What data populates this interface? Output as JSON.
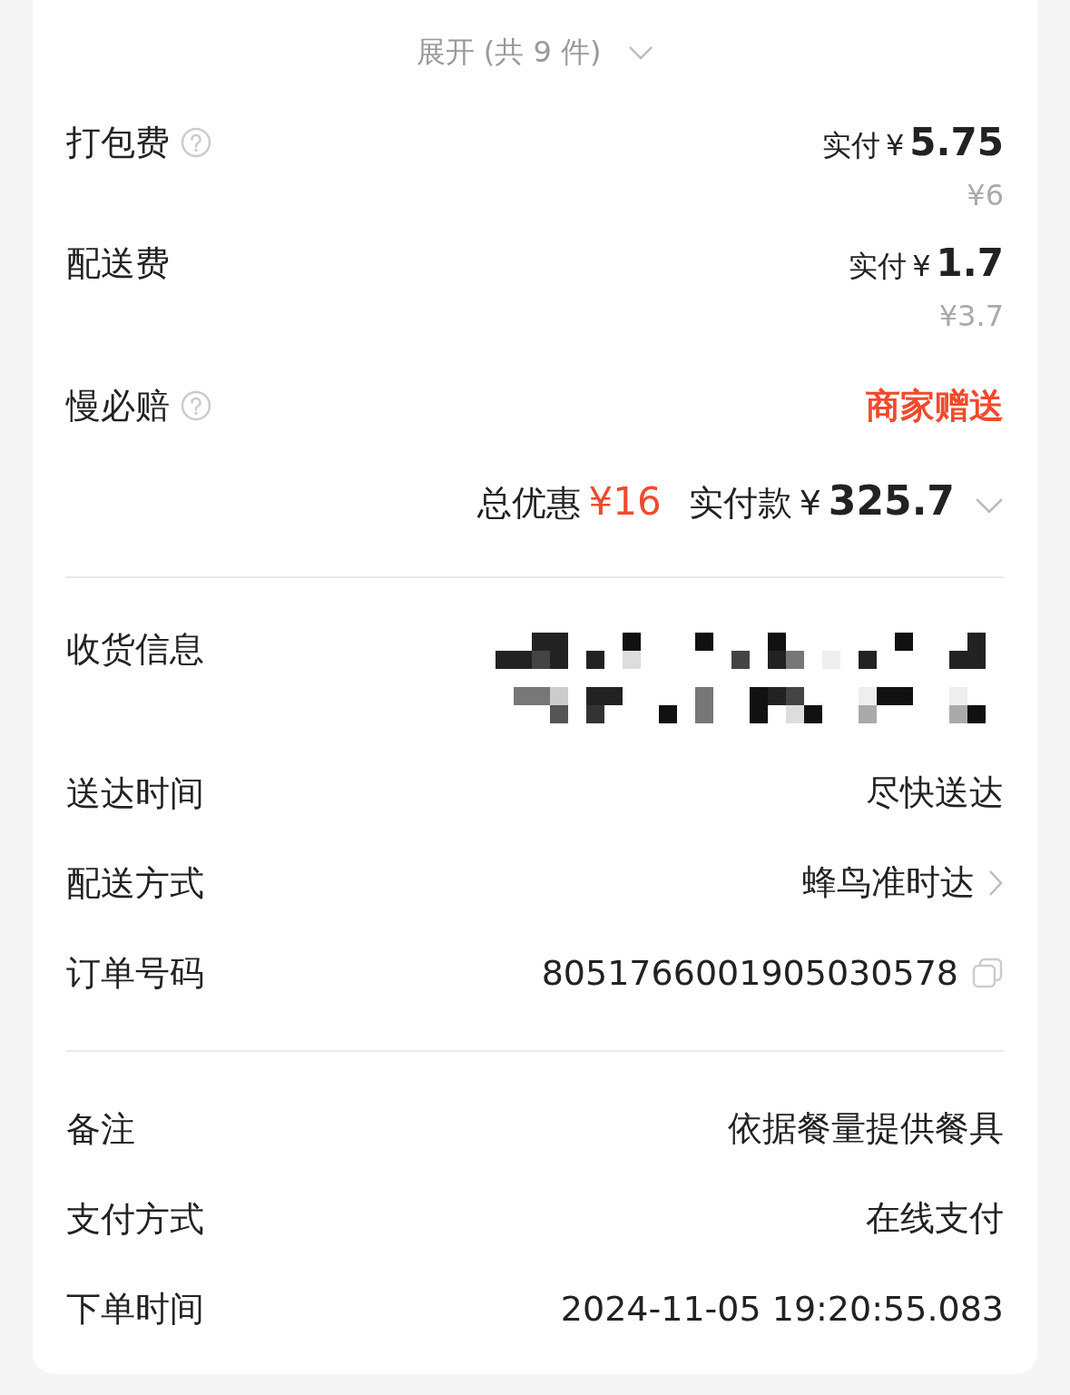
{
  "expand": {
    "label": "展开 (共 9 件)"
  },
  "fees": [
    {
      "kind": "price",
      "label": "打包费",
      "help": true,
      "paid_label": "实付",
      "currency": "¥",
      "paid": "5.75",
      "original": "¥6"
    },
    {
      "kind": "price",
      "label": "配送费",
      "help": false,
      "paid_label": "实付",
      "currency": "¥",
      "paid": "1.7",
      "original": "¥3.7"
    },
    {
      "kind": "gift",
      "label": "慢必赔",
      "help": true,
      "value": "商家赠送"
    }
  ],
  "summary": {
    "discount_label": "总优惠",
    "discount": "¥16",
    "paid_label": "实付款",
    "currency": "¥",
    "total": "325.7"
  },
  "sections": [
    [
      {
        "kind": "redacted",
        "label": "收货信息"
      },
      {
        "kind": "text",
        "label": "送达时间",
        "value": "尽快送达"
      },
      {
        "kind": "link",
        "label": "配送方式",
        "value": "蜂鸟准时达"
      },
      {
        "kind": "copy",
        "label": "订单号码",
        "value": "8051766001905030578"
      }
    ],
    [
      {
        "kind": "text",
        "label": "备注",
        "value": "依据餐量提供餐具"
      },
      {
        "kind": "text",
        "label": "支付方式",
        "value": "在线支付"
      },
      {
        "kind": "text",
        "label": "下单时间",
        "value": "2024-11-05 19:20:55.083"
      }
    ]
  ]
}
